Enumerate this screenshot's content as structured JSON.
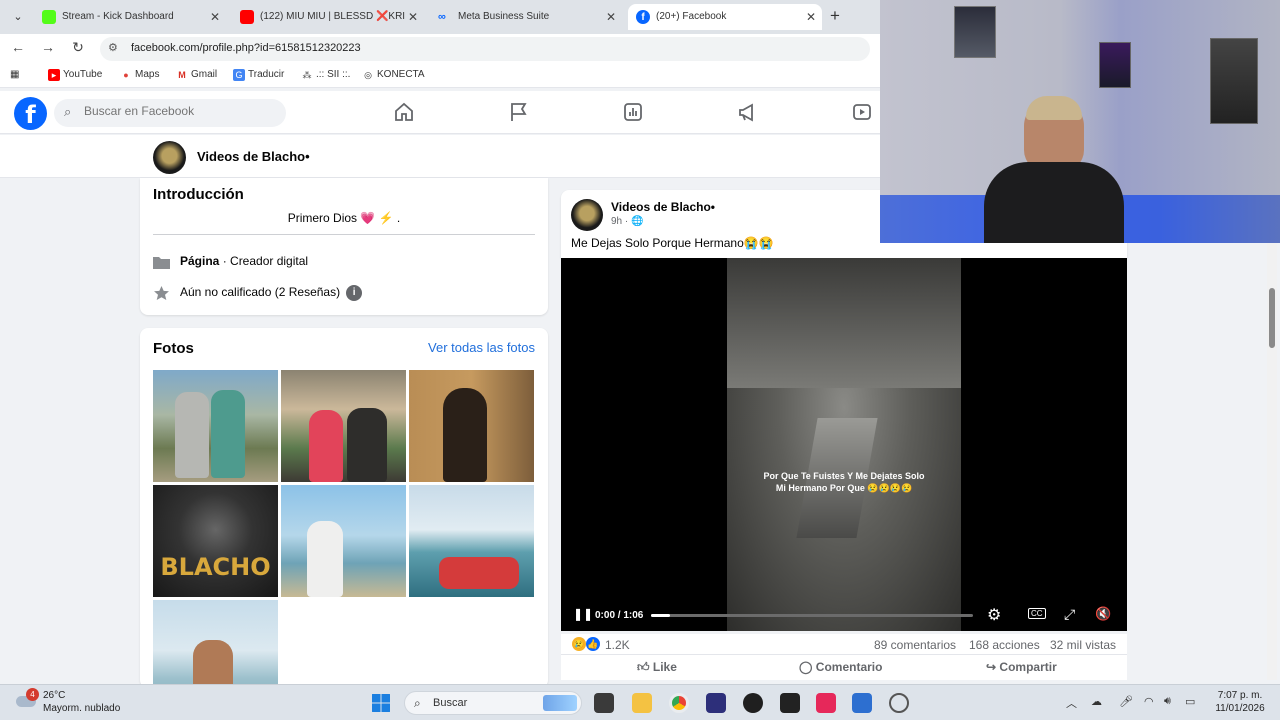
{
  "browser": {
    "tabs": [
      {
        "title": "Stream - Kick Dashboard",
        "favicon_color": "#53fc18"
      },
      {
        "title": "(122) MIU MIU | BLESSD ❌KRI",
        "favicon_color": "#ff0000"
      },
      {
        "title": "Meta Business Suite",
        "favicon_color": "#0866ff"
      },
      {
        "title": "(20+) Facebook",
        "favicon_color": "#0866ff"
      }
    ],
    "url": "facebook.com/profile.php?id=61581512320223",
    "bookmarks": [
      "YouTube",
      "Maps",
      "Gmail",
      "Traducir",
      ".:: SII ::.",
      "KONECTA"
    ]
  },
  "facebook": {
    "search_placeholder": "Buscar en Facebook",
    "nav_icons": [
      "home-icon",
      "flag-icon",
      "chart-icon",
      "megaphone-icon",
      "video-icon"
    ],
    "profile_name": "Videos de Blacho•",
    "intro": {
      "title": "Introducción",
      "bio": "Primero Dios 💗 ⚡ .",
      "category_label": "Página",
      "category_value": " · Creador digital",
      "rating": "Aún no calificado (2 Reseñas)"
    },
    "photos": {
      "title": "Fotos",
      "see_all": "Ver todas las fotos"
    },
    "post": {
      "author": "Videos de Blacho•",
      "time": "9h · ",
      "text": "Me Dejas Solo Porque Hermano😭😭",
      "video_caption_line1": "Por Que Te Fuistes Y Me Dejates Solo",
      "video_caption_line2": "Mi Hermano Por Que 😢😢😢😢",
      "video_time": "0:00 / 1:06",
      "progress": 0.06,
      "reactions_count": "1.2K",
      "comments": "89 comentarios",
      "shares": "168 acciones",
      "views": "32 mil vistas",
      "actions": {
        "like": "Like",
        "comment": "Comentario",
        "share": "Compartir"
      }
    }
  },
  "taskbar": {
    "weather_badge": "4",
    "temperature": "26°C",
    "weather_desc": "Mayorm. nublado",
    "search_label": "Buscar",
    "time": "7:07 p. m.",
    "date": "11/01/2026"
  }
}
